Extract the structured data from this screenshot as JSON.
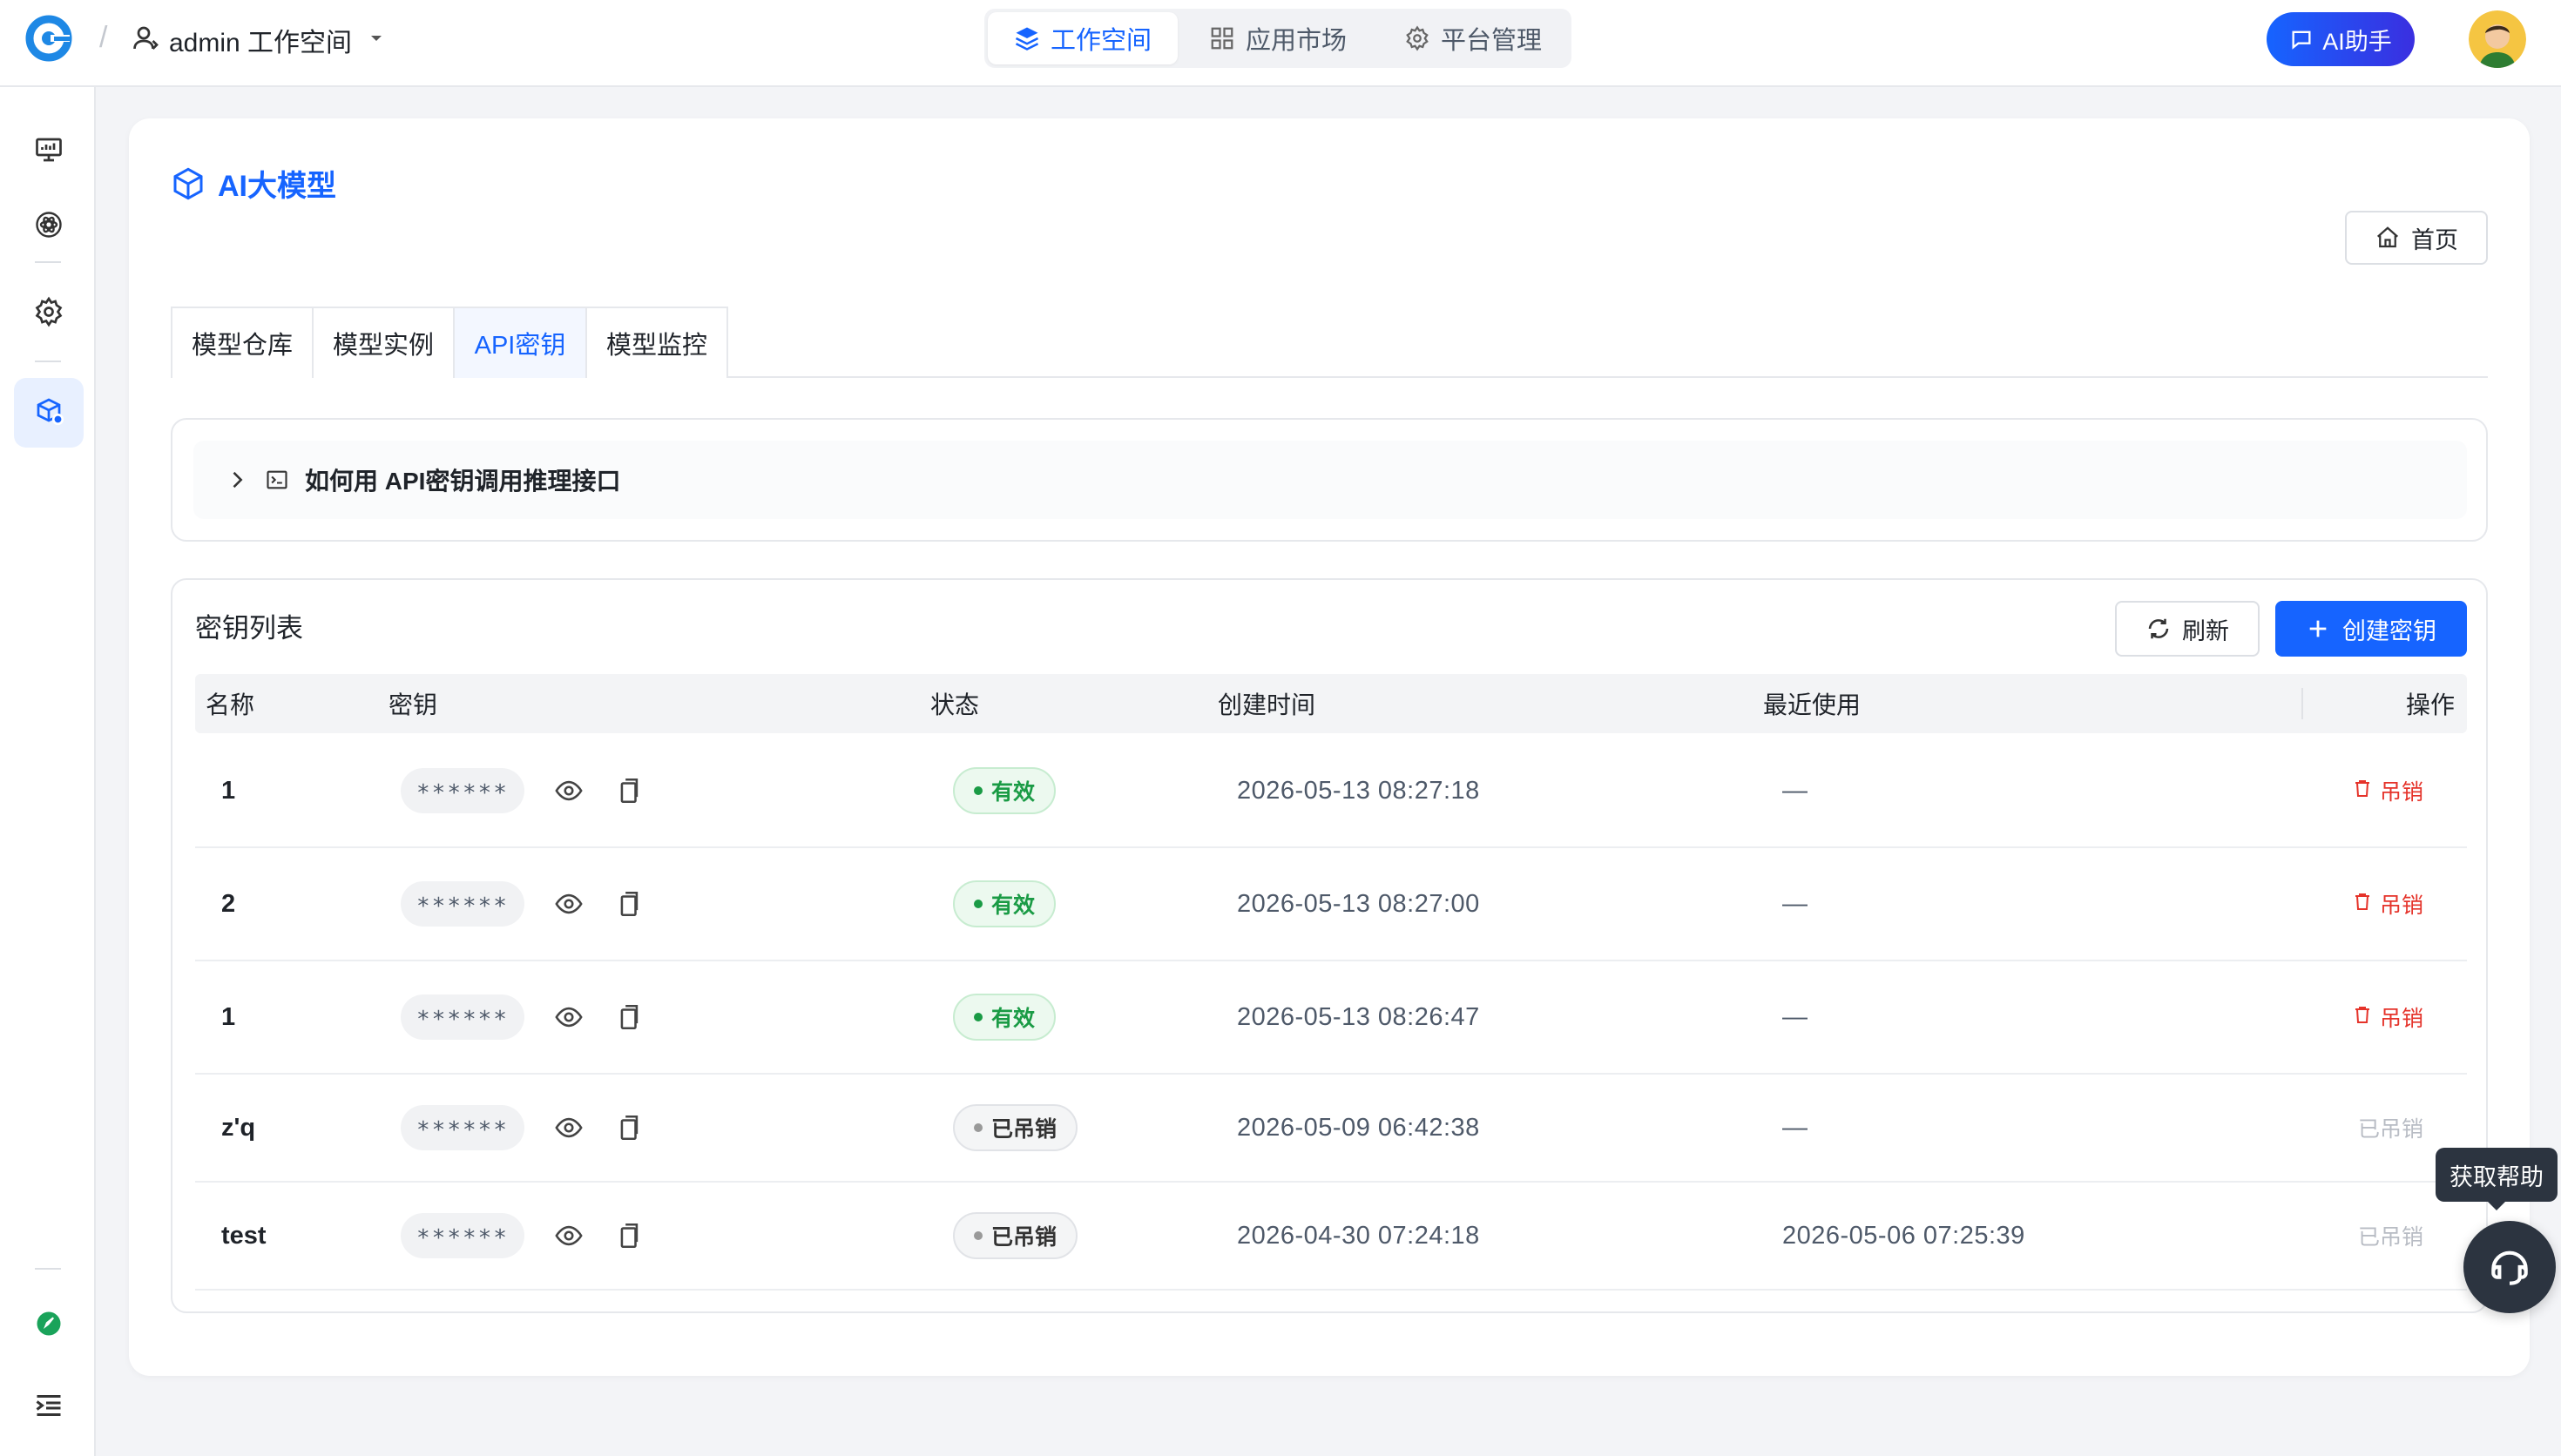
{
  "header": {
    "workspace_name": "admin 工作空间",
    "nav": [
      {
        "label": "工作空间",
        "icon": "layers-icon",
        "active": true
      },
      {
        "label": "应用市场",
        "icon": "grid-icon",
        "active": false
      },
      {
        "label": "平台管理",
        "icon": "gear-icon",
        "active": false
      }
    ],
    "ai_button": "AI助手"
  },
  "page": {
    "title": "AI大模型",
    "home_button": "首页",
    "tabs": [
      "模型仓库",
      "模型实例",
      "API密钥",
      "模型监控"
    ],
    "active_tab": "API密钥",
    "guide_title": "如何用 API密钥调用推理接口"
  },
  "keys": {
    "title": "密钥列表",
    "refresh_button": "刷新",
    "create_button": "创建密钥",
    "columns": [
      "名称",
      "密钥",
      "状态",
      "创建时间",
      "最近使用",
      "操作"
    ],
    "rows": [
      {
        "name": "1",
        "key": "******",
        "status": "有效",
        "status_type": "ok",
        "created": "2026-05-13 08:27:18",
        "last_used": "—",
        "action": "吊销",
        "action_type": "red"
      },
      {
        "name": "2",
        "key": "******",
        "status": "有效",
        "status_type": "ok",
        "created": "2026-05-13 08:27:00",
        "last_used": "—",
        "action": "吊销",
        "action_type": "red"
      },
      {
        "name": "1",
        "key": "******",
        "status": "有效",
        "status_type": "ok",
        "created": "2026-05-13 08:26:47",
        "last_used": "—",
        "action": "吊销",
        "action_type": "red"
      },
      {
        "name": "z'q",
        "key": "******",
        "status": "已吊销",
        "status_type": "revoked",
        "created": "2026-05-09 06:42:38",
        "last_used": "—",
        "action": "已吊销",
        "action_type": "gray"
      },
      {
        "name": "test",
        "key": "******",
        "status": "已吊销",
        "status_type": "revoked",
        "created": "2026-04-30 07:24:18",
        "last_used": "2026-05-06 07:25:39",
        "action": "已吊销",
        "action_type": "gray"
      }
    ]
  },
  "help": {
    "tooltip": "获取帮助"
  },
  "colors": {
    "accent": "#1664ff",
    "success": "#1a9b45",
    "danger": "#e5332a"
  }
}
